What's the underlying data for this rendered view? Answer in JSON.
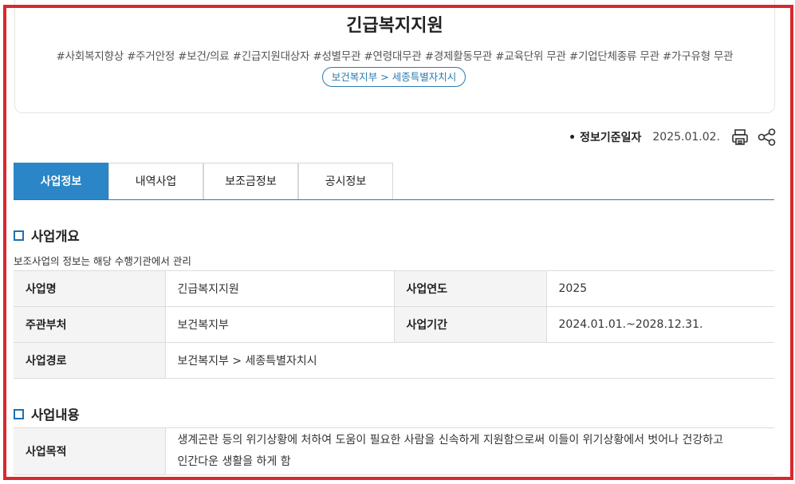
{
  "header": {
    "title": "긴급복지지원",
    "tags": "#사회복지향상 #주거안정 #보건/의료 #긴급지원대상자 #성별무관 #연령대무관 #경제활동무관 #교육단위 무관 #기업단체종류 무관 #가구유형 무관",
    "route": "보건복지부 > 세종특별자치시"
  },
  "meta": {
    "label": "정보기준일자",
    "date": "2025.01.02.",
    "print_icon": "printer-icon",
    "share_icon": "share-icon"
  },
  "tabs": [
    {
      "label": "사업정보",
      "active": true
    },
    {
      "label": "내역사업",
      "active": false
    },
    {
      "label": "보조금정보",
      "active": false
    },
    {
      "label": "공시정보",
      "active": false
    }
  ],
  "overview": {
    "heading": "사업개요",
    "note": "보조사업의 정보는 해당 수행기관에서 관리",
    "rows": [
      {
        "k1": "사업명",
        "v1": "긴급복지지원",
        "k2": "사업연도",
        "v2": "2025"
      },
      {
        "k1": "주관부처",
        "v1": "보건복지부",
        "k2": "사업기간",
        "v2": "2024.01.01.~2028.12.31."
      },
      {
        "k1": "사업경로",
        "v1": "보건복지부 > 세종특별자치시"
      }
    ]
  },
  "content": {
    "heading": "사업내용",
    "purpose_label": "사업목적",
    "purpose_line1": "생계곤란 등의 위기상황에 처하여 도움이 필요한 사람을 신속하게 지원함으로써 이들이 위기상황에서 벗어나 건강하고",
    "purpose_line2": "인간다운 생활을 하게 함"
  },
  "colors": {
    "accent": "#2a86c6",
    "frame": "#d9282f"
  }
}
